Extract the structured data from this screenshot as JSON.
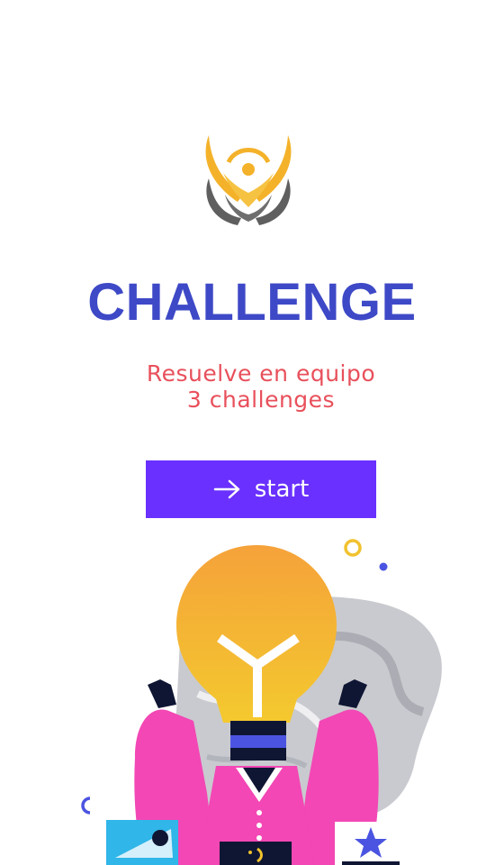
{
  "logo": {
    "icon": "winged-person-logo",
    "colors": {
      "gold": "#f4b22a",
      "gray": "#5f5f5f"
    }
  },
  "title": "CHALLENGE",
  "subtitle": {
    "line1": "Resuelve en equipo",
    "line2": "3 challenges"
  },
  "start_button": {
    "label": "start",
    "icon": "arrow-right-icon"
  },
  "illustration": {
    "icon": "lightbulb-person-illustration"
  },
  "colors": {
    "title": "#3d49c6",
    "subtitle": "#e8505b",
    "button": "#6930ff",
    "background": "#ffffff"
  }
}
